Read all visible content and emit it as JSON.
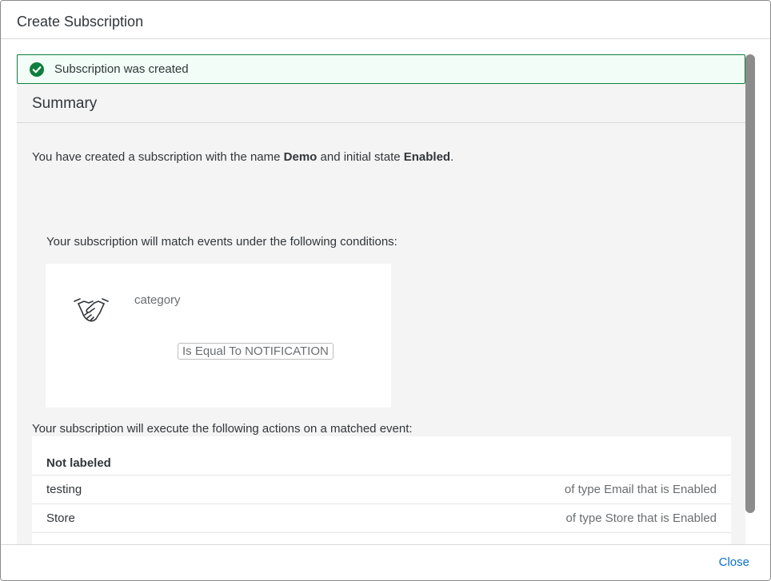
{
  "dialog": {
    "title": "Create Subscription",
    "close_label": "Close"
  },
  "message": {
    "text": "Subscription was created",
    "icon": "success-check-icon",
    "color": "#107e3e"
  },
  "summary": {
    "title": "Summary",
    "prefix": "You have created a subscription with the name ",
    "name": "Demo",
    "middle": " and initial state ",
    "state": "Enabled",
    "suffix": "."
  },
  "conditions": {
    "intro": "Your subscription will match events under the following conditions:",
    "icon": "handshake-icon",
    "field": "category",
    "operator": "Is Equal To NOTIFICATION"
  },
  "actions": {
    "intro": "Your subscription will execute the following actions on a matched event:",
    "group_label": "Not labeled",
    "items": [
      {
        "name": "testing",
        "description": "of type Email that is Enabled"
      },
      {
        "name": "Store",
        "description": "of type Store that is Enabled"
      }
    ]
  }
}
